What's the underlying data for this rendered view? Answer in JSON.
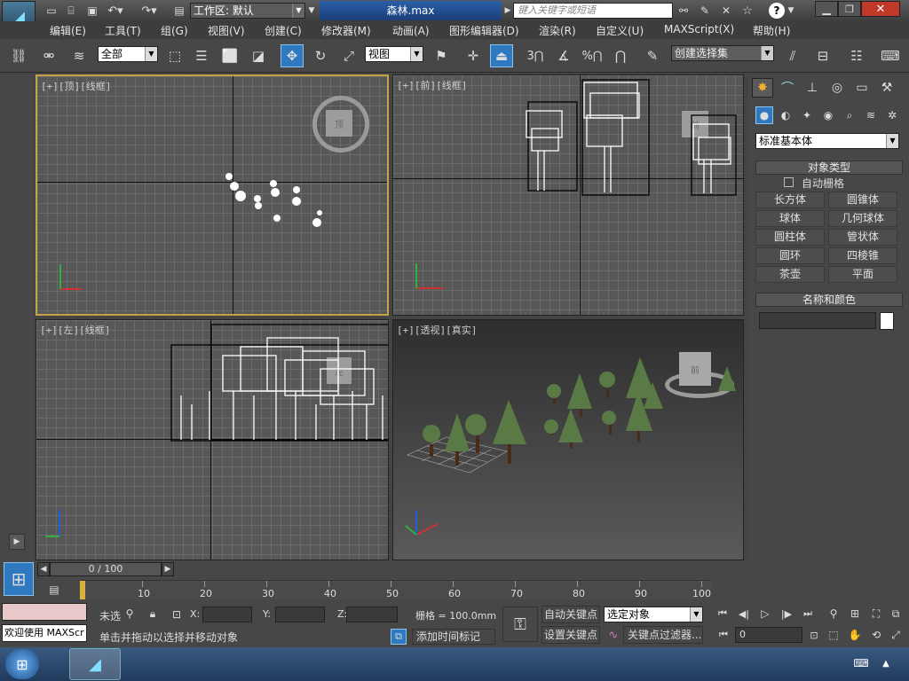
{
  "title": {
    "workspace_label": "工作区: 默认",
    "filename": "森林.max",
    "search_placeholder": "键入关键字或短语"
  },
  "menu": [
    "编辑(E)",
    "工具(T)",
    "组(G)",
    "视图(V)",
    "创建(C)",
    "修改器(M)",
    "动画(A)",
    "图形编辑器(D)",
    "渲染(R)",
    "自定义(U)",
    "MAXScript(X)",
    "帮助(H)"
  ],
  "toolbar": {
    "selection_filter": "全部",
    "reference_coord": "视图",
    "named_selection": "创建选择集",
    "snap_3": "3",
    "snap_angle": "%"
  },
  "viewports": {
    "top": "[+][顶][线框]",
    "front": "[+][前][线框]",
    "left": "[+][左][线框]",
    "persp": "[+][透视][真实]"
  },
  "cube_labels": {
    "top": "顶",
    "front": "前",
    "left": "左",
    "persp": "前"
  },
  "command_panel": {
    "category": "标准基本体",
    "object_type_title": "对象类型",
    "autogrid": "自动栅格",
    "buttons": [
      "长方体",
      "圆锥体",
      "球体",
      "几何球体",
      "圆柱体",
      "管状体",
      "圆环",
      "四棱锥",
      "茶壶",
      "平面"
    ],
    "name_color_title": "名称和颜色"
  },
  "timeline": {
    "slider_label": "0 / 100",
    "ticks": [
      "10",
      "20",
      "30",
      "40",
      "50",
      "60",
      "70",
      "80",
      "90",
      "100"
    ]
  },
  "status": {
    "welcome": "欢迎使用 MAXScr",
    "none_selected": "未选",
    "prompt": "单击并拖动以选择并移动对象",
    "x_label": "X:",
    "y_label": "Y:",
    "z_label": "Z:",
    "grid": "栅格 = 100.0mm",
    "auto_key": "自动关键点",
    "set_key": "设置关键点",
    "selected_object": "选定对象",
    "key_filters": "关键点过滤器...",
    "add_time_tag": "添加时间标记",
    "frame": "0"
  },
  "colors": {
    "accent": "#e8b040",
    "selection_yellow": "#c8a24a",
    "tree_green": "#5a7a45"
  }
}
